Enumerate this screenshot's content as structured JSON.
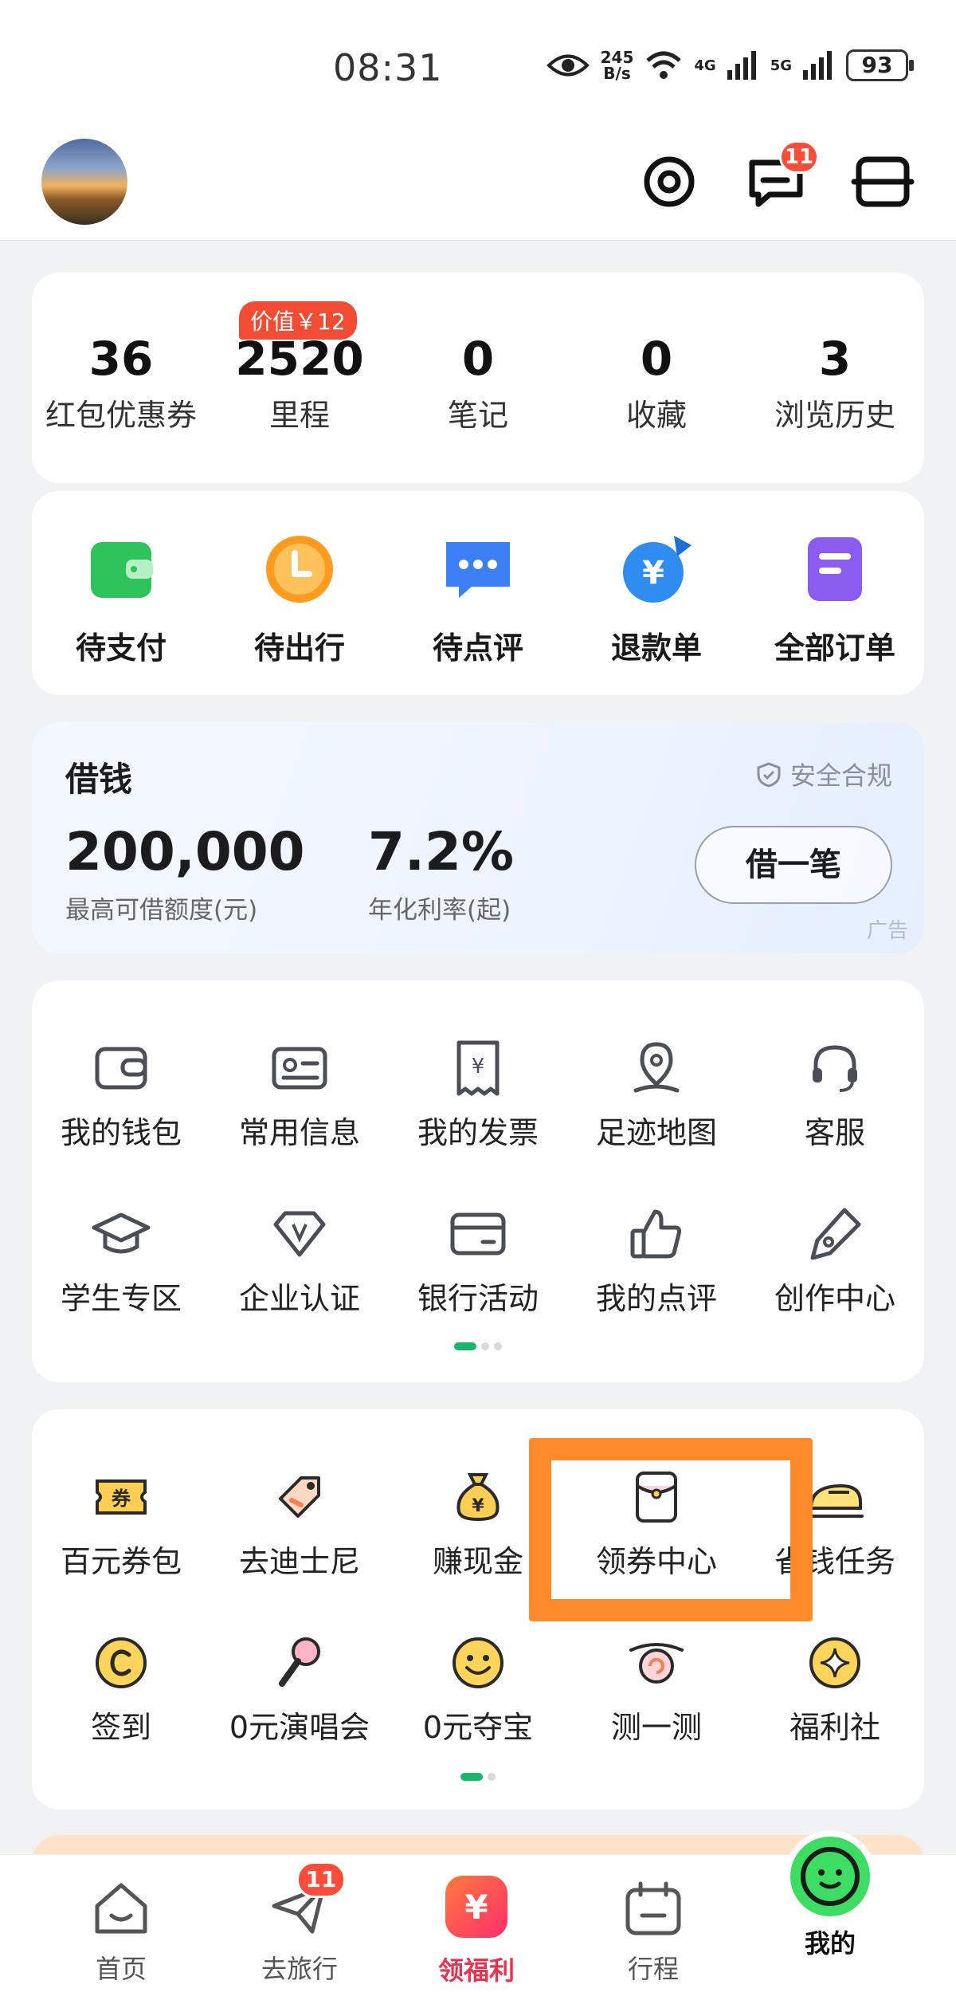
{
  "status_bar": {
    "time": "08:31",
    "speed_value": "245",
    "speed_unit": "B/s",
    "net1": "4G",
    "net2": "5G",
    "battery": "93"
  },
  "header": {
    "message_badge": "11"
  },
  "stats": {
    "value_tag": "价值￥12",
    "items": [
      {
        "num": "36",
        "label": "红包优惠券"
      },
      {
        "num": "2520",
        "label": "里程"
      },
      {
        "num": "0",
        "label": "笔记"
      },
      {
        "num": "0",
        "label": "收藏"
      },
      {
        "num": "3",
        "label": "浏览历史"
      }
    ]
  },
  "orders": [
    {
      "label": "待支付",
      "icon": "wallet-icon",
      "color": "#2fc35c"
    },
    {
      "label": "待出行",
      "icon": "clock-icon",
      "color": "#ff9b1e"
    },
    {
      "label": "待点评",
      "icon": "chat-icon",
      "color": "#3d7ff5"
    },
    {
      "label": "退款单",
      "icon": "yuan-refund-icon",
      "color": "#2f8cf0"
    },
    {
      "label": "全部订单",
      "icon": "document-icon",
      "color": "#8a5df0"
    }
  ],
  "loan": {
    "title": "借钱",
    "safe_label": "安全合规",
    "amount": "200,000",
    "amount_label": "最高可借额度(元)",
    "rate": "7.2%",
    "rate_label": "年化利率(起)",
    "button": "借一笔",
    "ad": "广告"
  },
  "tools": [
    {
      "label": "我的钱包",
      "icon": "wallet-outline-icon"
    },
    {
      "label": "常用信息",
      "icon": "id-card-icon"
    },
    {
      "label": "我的发票",
      "icon": "invoice-icon"
    },
    {
      "label": "足迹地图",
      "icon": "map-pin-icon"
    },
    {
      "label": "客服",
      "icon": "headset-icon"
    },
    {
      "label": "学生专区",
      "icon": "graduation-cap-icon"
    },
    {
      "label": "企业认证",
      "icon": "diamond-badge-icon"
    },
    {
      "label": "银行活动",
      "icon": "bank-card-icon"
    },
    {
      "label": "我的点评",
      "icon": "thumbs-up-icon"
    },
    {
      "label": "创作中心",
      "icon": "pen-nib-icon"
    }
  ],
  "welfare": [
    {
      "label": "百元券包",
      "icon": "coupon-icon"
    },
    {
      "label": "去迪士尼",
      "icon": "ticket-tag-icon"
    },
    {
      "label": "赚现金",
      "icon": "money-bag-icon"
    },
    {
      "label": "领券中心",
      "icon": "red-envelope-icon"
    },
    {
      "label": "省钱任务",
      "icon": "train-icon"
    },
    {
      "label": "签到",
      "icon": "checkin-coin-icon"
    },
    {
      "label": "0元演唱会",
      "icon": "microphone-icon"
    },
    {
      "label": "0元夺宝",
      "icon": "smiley-icon"
    },
    {
      "label": "测一测",
      "icon": "snail-icon"
    },
    {
      "label": "福利社",
      "icon": "sparkle-coin-icon"
    }
  ],
  "tabbar": {
    "travel_badge": "11",
    "items": [
      {
        "label": "首页",
        "icon": "home-icon"
      },
      {
        "label": "去旅行",
        "icon": "plane-icon"
      },
      {
        "label": "领福利",
        "icon": "yuan-gift-icon"
      },
      {
        "label": "行程",
        "icon": "calendar-icon"
      },
      {
        "label": "我的",
        "icon": "smiley-face-icon"
      }
    ]
  },
  "colors": {
    "accent_green": "#19b56a",
    "highlight_orange": "#ff8a2c",
    "badge_red": "#ff4b3a",
    "welfare_red": "#e8344f"
  }
}
